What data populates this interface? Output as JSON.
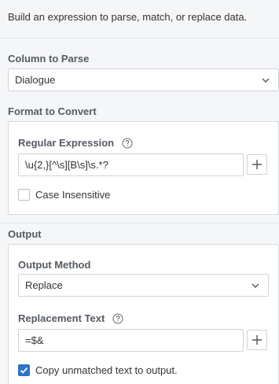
{
  "description": "Build an expression to parse, match, or replace data.",
  "column_section": {
    "label": "Column to Parse",
    "selected": "Dialogue"
  },
  "format_section": {
    "label": "Format to Convert",
    "regex_label": "Regular Expression",
    "regex_value": "\\u{2,}[^\\s][B\\s]\\s.*?",
    "case_insensitive_label": "Case Insensitive",
    "case_insensitive_checked": false
  },
  "output_section": {
    "label": "Output",
    "method_label": "Output Method",
    "method_selected": "Replace",
    "replacement_label": "Replacement Text",
    "replacement_value": "=$&",
    "copy_unmatched_label": "Copy unmatched text to output.",
    "copy_unmatched_checked": true
  },
  "icons": {
    "help": "help-circle-icon",
    "chevron": "chevron-down-icon",
    "plus": "plus-icon",
    "check": "check-icon"
  },
  "colors": {
    "accent": "#2d73c8",
    "background": "#f5f6f8",
    "panel": "#ffffff",
    "border": "#cfd3d8"
  }
}
